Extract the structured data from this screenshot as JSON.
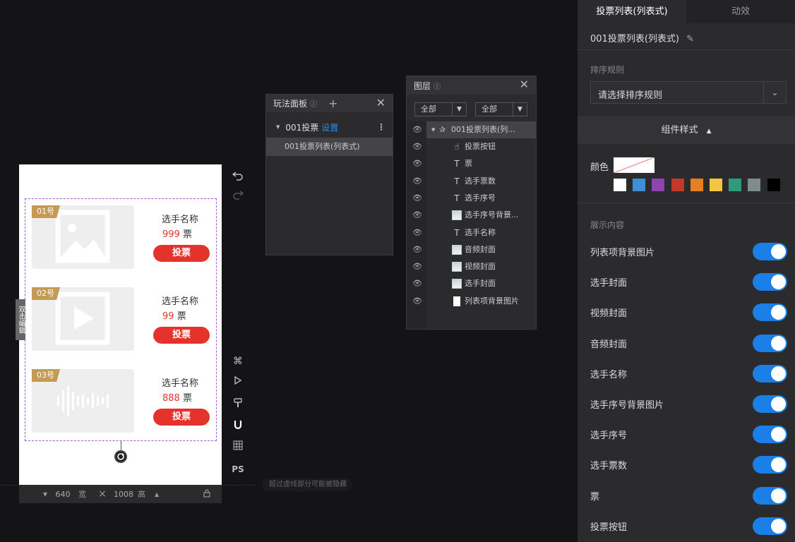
{
  "canvas": {
    "side_tab": "双击编辑",
    "cards": [
      {
        "badge": "01号",
        "name": "选手名称",
        "votes": "999",
        "unit": "票",
        "button": "投票",
        "media": "image"
      },
      {
        "badge": "02号",
        "name": "选手名称",
        "votes": "99",
        "unit": "票",
        "button": "投票",
        "media": "video"
      },
      {
        "badge": "03号",
        "name": "选手名称",
        "votes": "888",
        "unit": "票",
        "button": "投票",
        "media": "audio"
      }
    ],
    "size": {
      "width": "640",
      "width_label": "宽",
      "height": "1008",
      "height_label": "高"
    },
    "hint": "超过虚线部分可能被隐藏"
  },
  "toolbar": {
    "ps_label": "PS"
  },
  "play_panel": {
    "title": "玩法面板",
    "group_name": "001投票",
    "group_link": "设置",
    "item": "001投票列表(列表式)"
  },
  "layer_panel": {
    "title": "图层",
    "filter1": "全部",
    "filter2": "全部",
    "root": "001投票列表(列...",
    "items": [
      {
        "label": "投票按钮",
        "icon": "pointer-icon"
      },
      {
        "label": "票",
        "icon": "text-icon"
      },
      {
        "label": "选手票数",
        "icon": "text-icon"
      },
      {
        "label": "选手序号",
        "icon": "text-icon"
      },
      {
        "label": "选手序号背景...",
        "icon": "image-icon"
      },
      {
        "label": "选手名称",
        "icon": "text-icon"
      },
      {
        "label": "音频封面",
        "icon": "image-icon"
      },
      {
        "label": "视频封面",
        "icon": "image-icon"
      },
      {
        "label": "选手封面",
        "icon": "image-icon"
      },
      {
        "label": "列表项背景图片",
        "icon": "page-icon"
      }
    ]
  },
  "right_panel": {
    "tabs": [
      "投票列表(列表式)",
      "动效"
    ],
    "component_name": "001投票列表(列表式)",
    "sort_label": "排序规则",
    "sort_placeholder": "请选择排序规则",
    "style_section": "组件样式",
    "color_label": "颜色",
    "swatches": [
      "#ffffff",
      "#3f8fd4",
      "#8e44ad",
      "#c0392b",
      "#e67e22",
      "#f4c542",
      "#2e9c7c",
      "#7f8c8d",
      "#000000"
    ],
    "display_section": "展示内容",
    "toggles": [
      {
        "label": "列表项背景图片",
        "on": true
      },
      {
        "label": "选手封面",
        "on": true
      },
      {
        "label": "视频封面",
        "on": true
      },
      {
        "label": "音频封面",
        "on": true
      },
      {
        "label": "选手名称",
        "on": true
      },
      {
        "label": "选手序号背景图片",
        "on": true
      },
      {
        "label": "选手序号",
        "on": true
      },
      {
        "label": "选手票数",
        "on": true
      },
      {
        "label": "票",
        "on": true
      },
      {
        "label": "投票按钮",
        "on": true
      }
    ]
  }
}
